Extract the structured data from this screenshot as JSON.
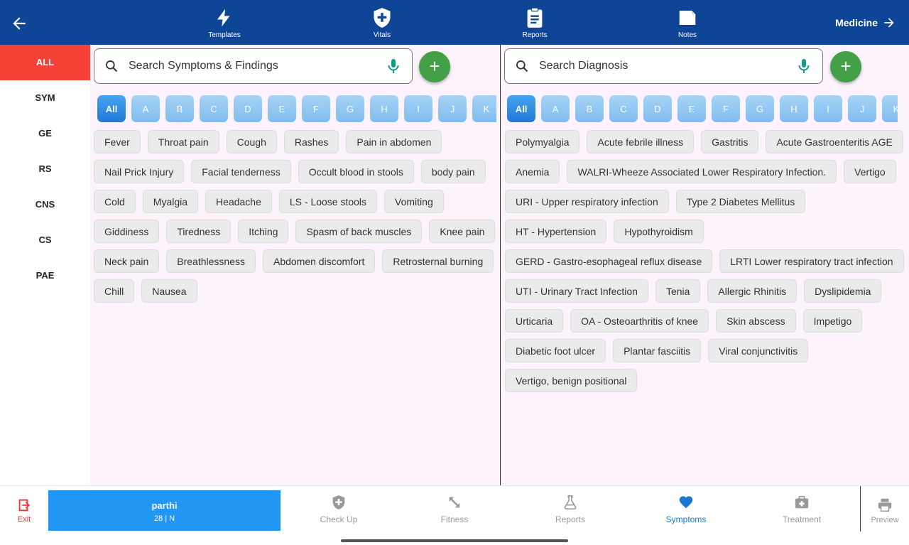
{
  "topbar": {
    "back_icon": "arrow-left-icon",
    "items": [
      {
        "label": "Templates",
        "icon": "lightning-icon"
      },
      {
        "label": "Vitals",
        "icon": "shield-plus-icon"
      },
      {
        "label": "Reports",
        "icon": "clipboard-icon"
      },
      {
        "label": "Notes",
        "icon": "note-icon"
      }
    ],
    "medicine_label": "Medicine"
  },
  "sidebar": {
    "items": [
      {
        "label": "ALL",
        "active": true
      },
      {
        "label": "SYM"
      },
      {
        "label": "GE"
      },
      {
        "label": "RS"
      },
      {
        "label": "CNS"
      },
      {
        "label": "CS"
      },
      {
        "label": "PAE"
      }
    ]
  },
  "symptoms": {
    "search_placeholder": "Search Symptoms & Findings",
    "alphabet": [
      "All",
      "A",
      "B",
      "C",
      "D",
      "E",
      "F",
      "G",
      "H",
      "I",
      "J",
      "K"
    ],
    "chips": [
      "Fever",
      "Throat pain",
      "Cough",
      "Rashes",
      "Pain in abdomen",
      "Nail Prick Injury",
      "Facial tenderness",
      "Occult blood in stools",
      "body pain",
      "Cold",
      "Myalgia",
      "Headache",
      "LS - Loose stools",
      "Vomiting",
      "Giddiness",
      "Tiredness",
      "Itching",
      "Spasm of back muscles",
      "Knee pain",
      "Neck pain",
      "Breathlessness",
      "Abdomen discomfort",
      "Retrosternal burning",
      "Chill",
      "Nausea"
    ]
  },
  "diagnosis": {
    "search_placeholder": "Search Diagnosis",
    "alphabet": [
      "All",
      "A",
      "B",
      "C",
      "D",
      "E",
      "F",
      "G",
      "H",
      "I",
      "J",
      "K"
    ],
    "chips": [
      "Polymyalgia",
      "Acute febrile illness",
      "Gastritis",
      "Acute Gastroenteritis AGE",
      "Anemia",
      "WALRI-Wheeze Associated Lower Respiratory Infection.",
      "Vertigo",
      "URI - Upper respiratory infection",
      "Type 2 Diabetes Mellitus",
      "HT - Hypertension",
      "Hypothyroidism",
      "GERD - Gastro-esophageal reflux disease",
      "LRTI Lower respiratory tract infection",
      "UTI - Urinary Tract Infection",
      "Tenia",
      "Allergic Rhinitis",
      "Dyslipidemia",
      "Urticaria",
      "OA - Osteoarthritis of knee",
      "Skin abscess",
      "Impetigo",
      "Diabetic foot ulcer",
      "Plantar fasciitis",
      "Viral conjunctivitis",
      "Vertigo, benign positional"
    ]
  },
  "bottombar": {
    "exit_label": "Exit",
    "patient": {
      "name": "parthi",
      "info": "28 | N"
    },
    "nav": [
      {
        "label": "Check Up",
        "icon": "shield-plus-icon"
      },
      {
        "label": "Fitness",
        "icon": "expand-arrows-icon"
      },
      {
        "label": "Reports",
        "icon": "flask-icon"
      },
      {
        "label": "Symptoms",
        "icon": "heart-icon",
        "active": true
      },
      {
        "label": "Treatment",
        "icon": "medkit-icon"
      }
    ],
    "preview_label": "Preview"
  },
  "colors": {
    "topbar": "#0f4596",
    "sidebar_active": "#f44336",
    "add_button": "#43a047",
    "mic": "#0f9d8a",
    "patient_card": "#2196f3",
    "nav_active": "#1976d2",
    "pane_bg": "#fcf3fd"
  }
}
